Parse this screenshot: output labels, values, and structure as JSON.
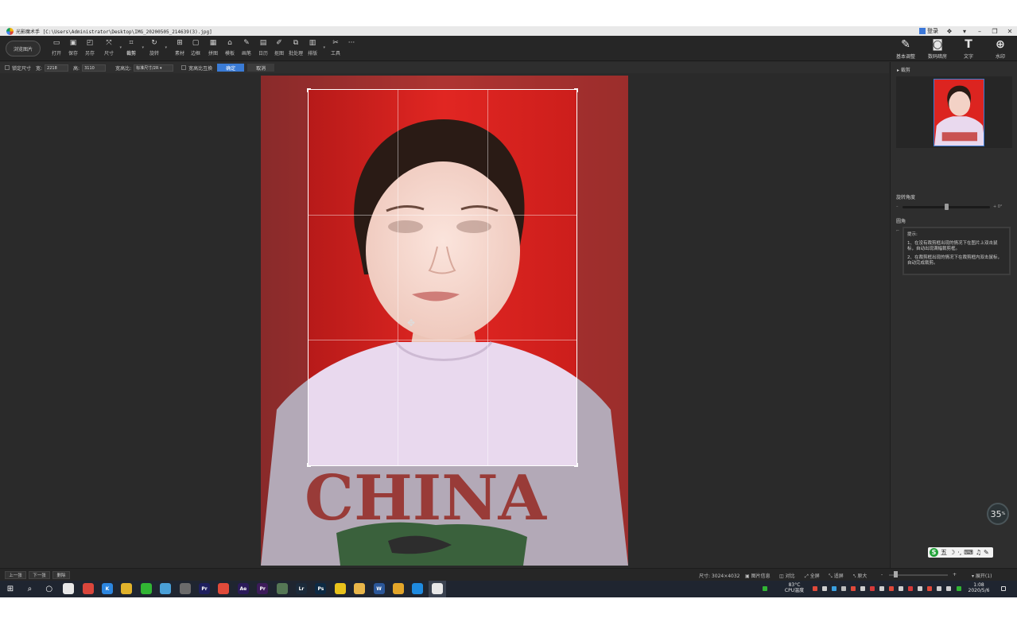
{
  "titlebar": {
    "app_name": "光影魔术手",
    "file_path": "[C:\\Users\\Administrator\\Desktop\\IMG_20200505_214639(3).jpg]",
    "login_label": "登录"
  },
  "toolbar": {
    "browse_label": "浏览图片",
    "tools": [
      {
        "label": "打开",
        "icon": "open-icon"
      },
      {
        "label": "保存",
        "icon": "save-icon"
      },
      {
        "label": "另存",
        "icon": "save-as-icon"
      },
      {
        "label": "尺寸",
        "icon": "resize-icon"
      },
      {
        "label": "裁剪",
        "icon": "crop-icon"
      },
      {
        "label": "旋转",
        "icon": "rotate-icon"
      },
      {
        "label": "素材",
        "icon": "material-icon"
      },
      {
        "label": "边框",
        "icon": "border-icon"
      },
      {
        "label": "拼图",
        "icon": "collage-icon"
      },
      {
        "label": "模板",
        "icon": "template-icon"
      },
      {
        "label": "画笔",
        "icon": "brush-icon"
      },
      {
        "label": "日历",
        "icon": "calendar-icon"
      },
      {
        "label": "抠图",
        "icon": "cutout-icon"
      },
      {
        "label": "批处理",
        "icon": "batch-icon"
      },
      {
        "label": "排版",
        "icon": "layout-icon"
      },
      {
        "label": "工具",
        "icon": "tools-icon"
      }
    ],
    "more_label": "···",
    "right_tools": [
      {
        "label": "基本调整",
        "icon": "adjust-icon"
      },
      {
        "label": "数码暗房",
        "icon": "darkroom-icon"
      },
      {
        "label": "文字",
        "icon": "text-icon"
      },
      {
        "label": "水印",
        "icon": "watermark-icon"
      }
    ]
  },
  "options": {
    "lock_size_label": "锁定尺寸",
    "width_label": "宽:",
    "width_value": "2218",
    "height_label": "高:",
    "height_value": "3110",
    "ratio_label": "宽高比:",
    "ratio_value": "标准尺寸/2R",
    "swap_label": "宽高比互换",
    "ok_label": "确定",
    "cancel_label": "取消"
  },
  "right_panel": {
    "section_title": "裁剪",
    "rotate_label": "旋转角度",
    "rotate_value": "0°",
    "rotate_fraction": 0.5,
    "corner_label": "圆角",
    "corner_fraction": 0,
    "tip_title": "提示:",
    "tip_1": "1、在没有裁剪框出现的情况下在图片上双击鼠标，自动出现满幅裁剪框。",
    "tip_2": "2、在裁剪框出现的情况下在裁剪框内双击鼠标，自动完成裁剪。"
  },
  "photo": {
    "shirt_text": "CHINA"
  },
  "widgets": {
    "speed_value": "35",
    "speed_unit": "%",
    "ime_label": "五"
  },
  "statusbar": {
    "prev_label": "上一张",
    "next_label": "下一张",
    "delete_label": "删除",
    "size_label": "尺寸: 3024×4032",
    "info_label": "图片信息",
    "compare_label": "对比",
    "fullscreen_label": "全屏",
    "fit_label": "适屏",
    "original_label": "原大",
    "zoom_minus": "-",
    "zoom_plus": "+",
    "expand_label": "展开(1)"
  },
  "taskbar": {
    "temp_value": "83°C",
    "temp_label": "CPU温度",
    "time": "1:08",
    "date": "2020/5/6",
    "apps": [
      {
        "name": "windows-start-icon",
        "color": "#1f2530",
        "text": "⊞"
      },
      {
        "name": "search-icon",
        "color": "#1f2530",
        "text": "⌕"
      },
      {
        "name": "task-view-icon",
        "color": "#1f2530",
        "text": "○"
      },
      {
        "name": "qq-icon",
        "color": "#e8e8e8",
        "text": ""
      },
      {
        "name": "browser-red-icon",
        "color": "#d9463c",
        "text": ""
      },
      {
        "name": "k-app-icon",
        "color": "#2c86e0",
        "text": "K"
      },
      {
        "name": "chrome-icon",
        "color": "#e0b22c",
        "text": ""
      },
      {
        "name": "wechat-icon",
        "color": "#31b534",
        "text": ""
      },
      {
        "name": "game-icon",
        "color": "#4aa0d8",
        "text": ""
      },
      {
        "name": "app-icon-gray",
        "color": "#6b6b6b",
        "text": ""
      },
      {
        "name": "premiere-dark-icon",
        "color": "#1e1f5e",
        "text": "Pr"
      },
      {
        "name": "chrome-2-icon",
        "color": "#e04a3a",
        "text": ""
      },
      {
        "name": "after-effects-icon",
        "color": "#2b1a5a",
        "text": "Ae"
      },
      {
        "name": "premiere-icon",
        "color": "#3c1b5a",
        "text": "Pr"
      },
      {
        "name": "app-icon-photo",
        "color": "#557755",
        "text": ""
      },
      {
        "name": "lightroom-icon",
        "color": "#1b2a3a",
        "text": "Lr"
      },
      {
        "name": "photoshop-icon",
        "color": "#0d2a44",
        "text": "Ps"
      },
      {
        "name": "sticky-icon",
        "color": "#e8c21c",
        "text": ""
      },
      {
        "name": "folder-icon",
        "color": "#e8b64a",
        "text": ""
      },
      {
        "name": "word-icon",
        "color": "#2b579a",
        "text": "W"
      },
      {
        "name": "app-icon-yellow",
        "color": "#e2a52a",
        "text": ""
      },
      {
        "name": "app-icon-blue",
        "color": "#1e8ae0",
        "text": ""
      },
      {
        "name": "neoimaging-icon",
        "color": "#e8e8e8",
        "text": ""
      }
    ]
  },
  "colors": {
    "accent": "#3a7bd5",
    "background": "#2b2b2b",
    "photo_bg": "#d8201f"
  }
}
